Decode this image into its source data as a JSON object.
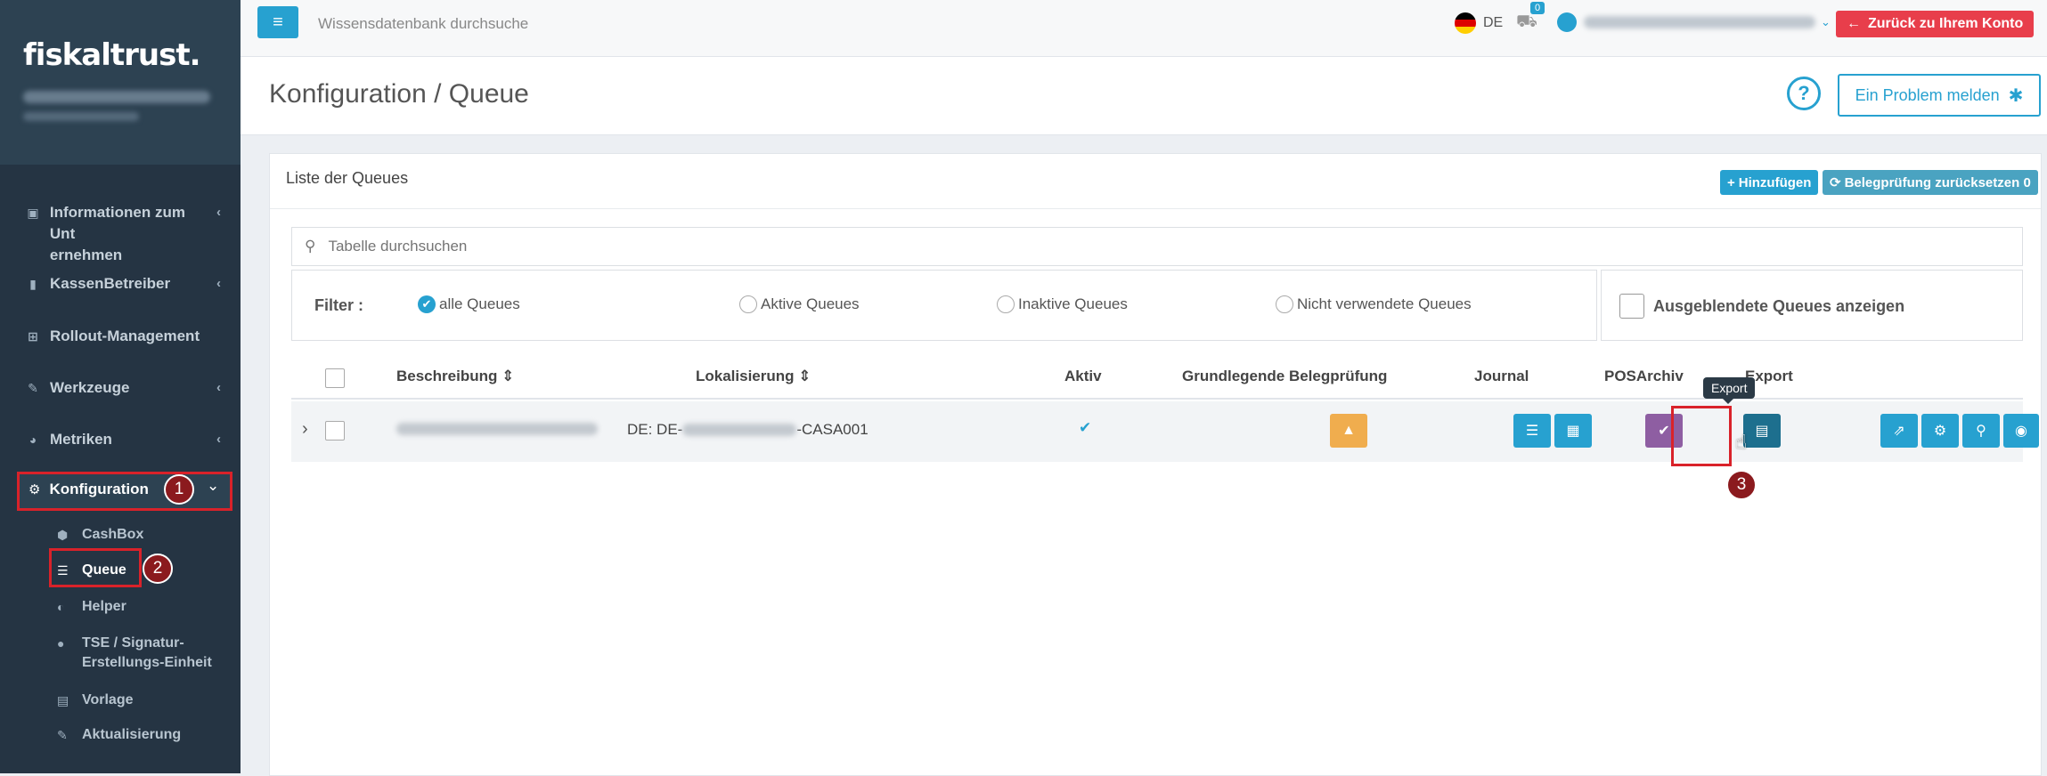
{
  "sidebar": {
    "logo": "fiskaltrust.",
    "items": [
      {
        "label_line1": "Informationen zum Unt",
        "label_line2": "ernehmen",
        "icon": "briefcase-icon",
        "chevron": "‹"
      },
      {
        "label": "KassenBetreiber",
        "icon": "book-icon",
        "chevron": "‹"
      },
      {
        "label": "Rollout-Management",
        "icon": "plus-square-icon",
        "chevron": ""
      },
      {
        "label": "Werkzeuge",
        "icon": "wrench-icon",
        "chevron": "‹"
      },
      {
        "label": "Metriken",
        "icon": "pie-chart-icon",
        "chevron": "‹"
      }
    ],
    "active": {
      "label": "Konfiguration",
      "icon": "cogs-icon",
      "chevron": "⌄",
      "step": "1"
    },
    "subitems": [
      {
        "label": "CashBox"
      },
      {
        "label": "Queue",
        "step": "2"
      },
      {
        "label": "Helper"
      },
      {
        "label_line1": "TSE / Signatur-",
        "label_line2": "Erstellungs-Einheit"
      },
      {
        "label": "Vorlage"
      },
      {
        "label": "Aktualisierung"
      }
    ]
  },
  "topbar": {
    "search_placeholder": "Wissensdatenbank durchsuche",
    "lang": "DE",
    "cart_count": "0",
    "back_label": "Zurück zu Ihrem Konto"
  },
  "header": {
    "title": "Konfiguration / Queue",
    "report_label": "Ein Problem melden"
  },
  "card": {
    "title": "Liste der Queues",
    "add_label": "Hinzufügen",
    "reset_label": "Belegprüfung zurücksetzen 0",
    "search_placeholder": "Tabelle durchsuchen",
    "filter_label": "Filter :",
    "filters": [
      "alle Queues",
      "Aktive Queues",
      "Inaktive Queues",
      "Nicht verwendete Queues"
    ],
    "hidden_label": "Ausgeblendete Queues anzeigen",
    "columns": [
      "Beschreibung",
      "Lokalisierung",
      "Aktiv",
      "Grundlegende Belegprüfung",
      "Journal",
      "POSArchiv",
      "Export"
    ],
    "row": {
      "loc_prefix": "DE: DE-",
      "loc_suffix": "-CASA001"
    },
    "tooltip": "Export",
    "step": "3"
  },
  "colors": {
    "accent": "#27a1d0",
    "warning": "#f0ad4e",
    "purple": "#8e5ea2",
    "danger": "#e83e4b",
    "marker": "#d9222a"
  }
}
